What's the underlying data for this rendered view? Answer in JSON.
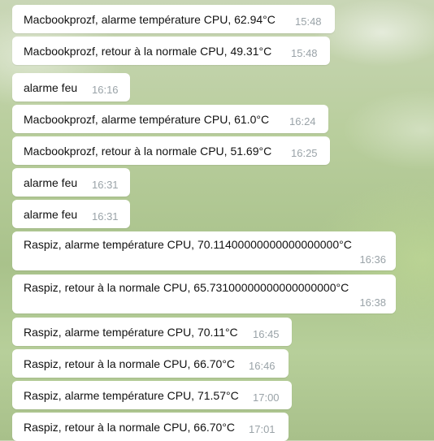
{
  "messages": [
    {
      "text": "Macbookprozf, alarme température CPU, 62.94°C",
      "time": "15:48"
    },
    {
      "text": "Macbookprozf, retour à la normale CPU, 49.31°C",
      "time": "15:48"
    },
    {
      "text": "alarme feu",
      "time": "16:16"
    },
    {
      "text": "Macbookprozf, alarme température CPU, 61.0°C",
      "time": "16:24"
    },
    {
      "text": "Macbookprozf, retour à la normale CPU, 51.69°C",
      "time": "16:25"
    },
    {
      "text": "alarme feu",
      "time": "16:31"
    },
    {
      "text": "alarme feu",
      "time": "16:31"
    },
    {
      "text": "Raspiz, alarme température CPU, 70.11400000000000000000°C",
      "time": "16:36"
    },
    {
      "text": "Raspiz, retour à la normale CPU, 65.73100000000000000000°C",
      "time": "16:38"
    },
    {
      "text": "Raspiz, alarme température CPU, 70.11°C",
      "time": "16:45"
    },
    {
      "text": "Raspiz, retour à la normale CPU, 66.70°C",
      "time": "16:46"
    },
    {
      "text": "Raspiz, alarme température CPU, 71.57°C",
      "time": "17:00"
    },
    {
      "text": "Raspiz, retour à la normale CPU, 66.70°C",
      "time": "17:01"
    }
  ]
}
